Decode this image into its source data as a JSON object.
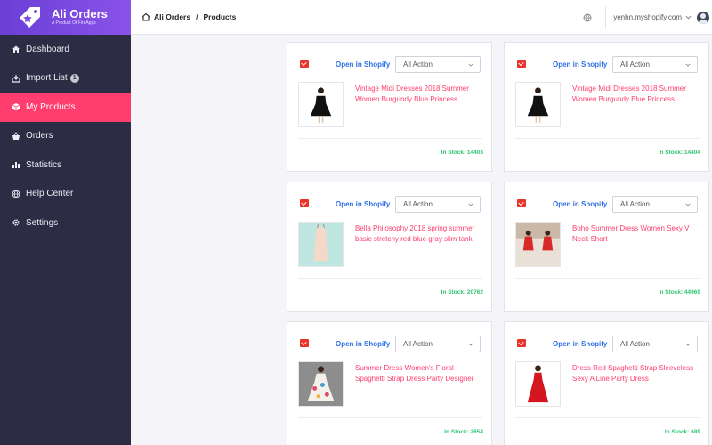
{
  "brand": {
    "name": "Ali Orders",
    "subtitle": "A Product Of FireApps"
  },
  "sidebar": {
    "items": [
      {
        "label": "Dashboard",
        "icon": "home-icon"
      },
      {
        "label": "Import List",
        "icon": "import-icon",
        "badge": "1"
      },
      {
        "label": "My Products",
        "icon": "box-icon",
        "active": true
      },
      {
        "label": "Orders",
        "icon": "basket-icon"
      },
      {
        "label": "Statistics",
        "icon": "bar-chart-icon"
      },
      {
        "label": "Help Center",
        "icon": "globe-icon"
      },
      {
        "label": "Settings",
        "icon": "gear-icon"
      }
    ]
  },
  "header": {
    "breadcrumb": [
      "Ali Orders",
      "Products"
    ],
    "separator": "/",
    "store": "yenhn.myshopify.com"
  },
  "products": [
    {
      "title": "Vintage Midi Dresses 2018 Summer Women Burgundy Blue Princess",
      "stock": "In Stock: 14403",
      "thumb": "black-dress"
    },
    {
      "title": "Vintage Midi Dresses 2018 Summer Women Burgundy Blue Princess",
      "stock": "In Stock: 14404",
      "thumb": "black-dress"
    },
    {
      "title": "Bella Philosophy 2018 spring summer basic stretchy red blue gray slim tank",
      "stock": "In Stock: 20762",
      "thumb": "tank-dress"
    },
    {
      "title": "Boho Summer Dress Women Sexy V Neck Short",
      "stock": "In Stock: 44969",
      "thumb": "red-short-dress"
    },
    {
      "title": "Summer Dress Women's Floral Spaghetti Strap Dress Party Designer",
      "stock": "In Stock: 2654",
      "thumb": "floral-dress"
    },
    {
      "title": "Dress Red Spaghetti Strap Sleeveless Sexy A Line Party Dress",
      "stock": "In Stock: 689",
      "thumb": "red-long-dress"
    }
  ],
  "card_labels": {
    "open": "Open in Shopify",
    "action": "All Action"
  },
  "colors": {
    "accent": "#ff3d6e",
    "brand": "#6a3fd6",
    "sidebar": "#2c2c45",
    "link": "#2f6fe4",
    "stock": "#2fc46f"
  }
}
